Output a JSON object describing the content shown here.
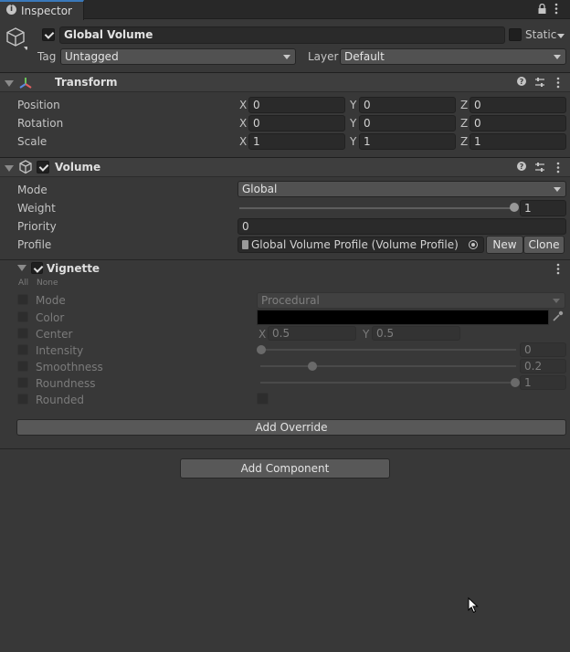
{
  "window": {
    "tab_label": "Inspector",
    "lock_icon": "lock-icon",
    "menu_icon": "kebab-icon"
  },
  "object": {
    "name": "Global Volume",
    "active": true,
    "static_label": "Static",
    "tag_label": "Tag",
    "tag_value": "Untagged",
    "layer_label": "Layer",
    "layer_value": "Default"
  },
  "transform": {
    "title": "Transform",
    "rows": [
      {
        "label": "Position",
        "x": "0",
        "y": "0",
        "z": "0"
      },
      {
        "label": "Rotation",
        "x": "0",
        "y": "0",
        "z": "0"
      },
      {
        "label": "Scale",
        "x": "1",
        "y": "1",
        "z": "1"
      }
    ],
    "axis_x": "X",
    "axis_y": "Y",
    "axis_z": "Z"
  },
  "volume": {
    "title": "Volume",
    "enabled": true,
    "mode_label": "Mode",
    "mode_value": "Global",
    "weight_label": "Weight",
    "weight_value": "1",
    "weight_fraction": 1.0,
    "priority_label": "Priority",
    "priority_value": "0",
    "profile_label": "Profile",
    "profile_value": "Global Volume Profile (Volume Profile)",
    "new_label": "New",
    "clone_label": "Clone"
  },
  "vignette": {
    "title": "Vignette",
    "enabled": true,
    "all_label": "All",
    "none_label": "None",
    "mode_label": "Mode",
    "mode_value": "Procedural",
    "color_label": "Color",
    "color_value": "#000000",
    "center_label": "Center",
    "center_x": "0.5",
    "center_y": "0.5",
    "intensity_label": "Intensity",
    "intensity_value": "0",
    "intensity_fraction": 0.0,
    "smoothness_label": "Smoothness",
    "smoothness_value": "0.2",
    "smoothness_fraction": 0.2,
    "roundness_label": "Roundness",
    "roundness_value": "1",
    "roundness_fraction": 1.0,
    "rounded_label": "Rounded",
    "axis_x": "X",
    "axis_y": "Y"
  },
  "add_override_label": "Add Override",
  "add_component_label": "Add Component",
  "colors": {
    "accent": "#3a79bb",
    "panel": "#383838",
    "field": "#2a2a2a"
  }
}
